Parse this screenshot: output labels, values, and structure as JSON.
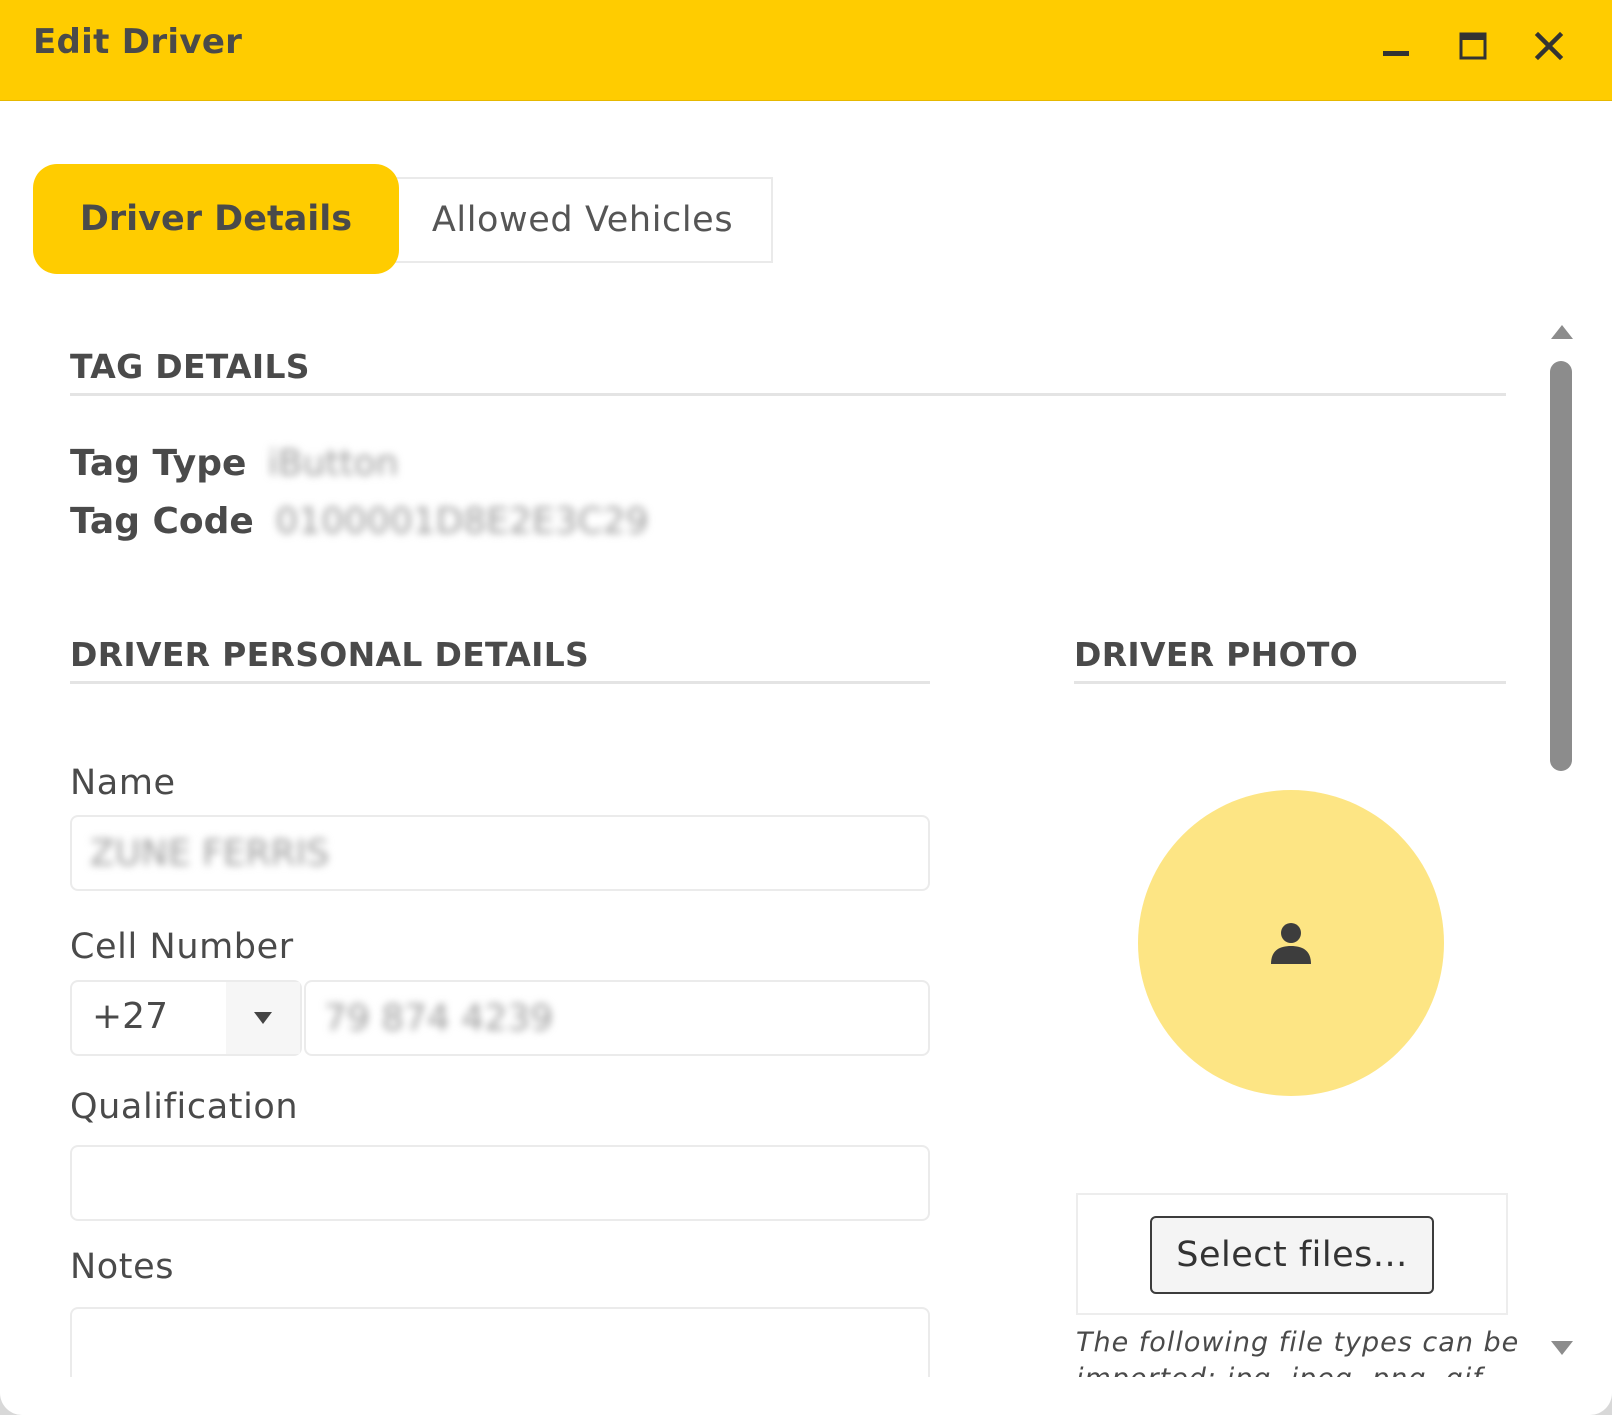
{
  "window": {
    "title": "Edit Driver"
  },
  "tabs": [
    {
      "label": "Driver Details",
      "active": true
    },
    {
      "label": "Allowed Vehicles",
      "active": false
    }
  ],
  "tag_details": {
    "heading": "TAG DETAILS",
    "tag_type_label": "Tag Type",
    "tag_type_value": "iButton",
    "tag_code_label": "Tag Code",
    "tag_code_value": "0100001D8E2E3C29"
  },
  "personal_details": {
    "heading": "DRIVER PERSONAL DETAILS",
    "name_label": "Name",
    "name_value": "ZUNE FERRIS",
    "cell_label": "Cell Number",
    "country_code": "+27",
    "cell_value": "79 874 4239",
    "qualification_label": "Qualification",
    "qualification_value": "",
    "notes_label": "Notes",
    "notes_value": ""
  },
  "photo": {
    "heading": "DRIVER PHOTO",
    "select_files_label": "Select files...",
    "hint_line1": "The following file types can be",
    "hint_line2": "imported: jpg, jpeg, png, gif"
  },
  "colors": {
    "accent": "#ffcc00",
    "avatar_bg": "#fde584",
    "text": "#4a4a4a"
  }
}
